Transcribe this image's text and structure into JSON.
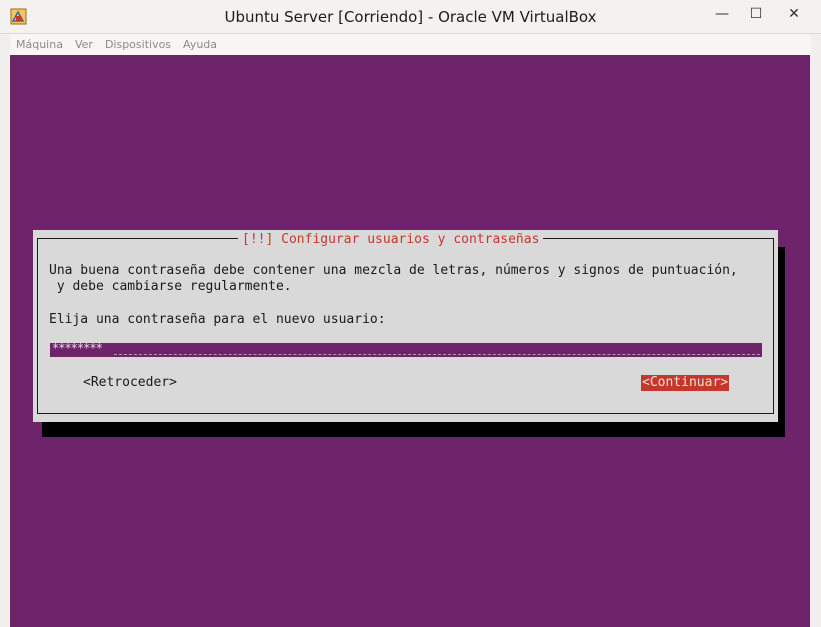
{
  "window": {
    "title": "Ubuntu Server [Corriendo] - Oracle VM VirtualBox",
    "controls": {
      "minimize": "—",
      "maximize": "☐",
      "close": "✕"
    }
  },
  "menubar": {
    "items": [
      "Máquina",
      "Ver",
      "Dispositivos",
      "Ayuda"
    ]
  },
  "dialog": {
    "title": "[!!] Configurar usuarios y contraseñas",
    "message_line1": "Una buena contraseña debe contener una mezcla de letras, números y signos de puntuación,",
    "message_line2": " y debe cambiarse regularmente.",
    "prompt": "Elija una contraseña para el nuevo usuario:",
    "password_value": "********",
    "back_button": "<Retroceder>",
    "continue_button": "<Continuar>"
  },
  "colors": {
    "vm_background": "#6e246b",
    "dialog_background": "#d9d9d9",
    "accent_red": "#c4382a"
  },
  "icons": {
    "app": "virtualbox-icon"
  }
}
